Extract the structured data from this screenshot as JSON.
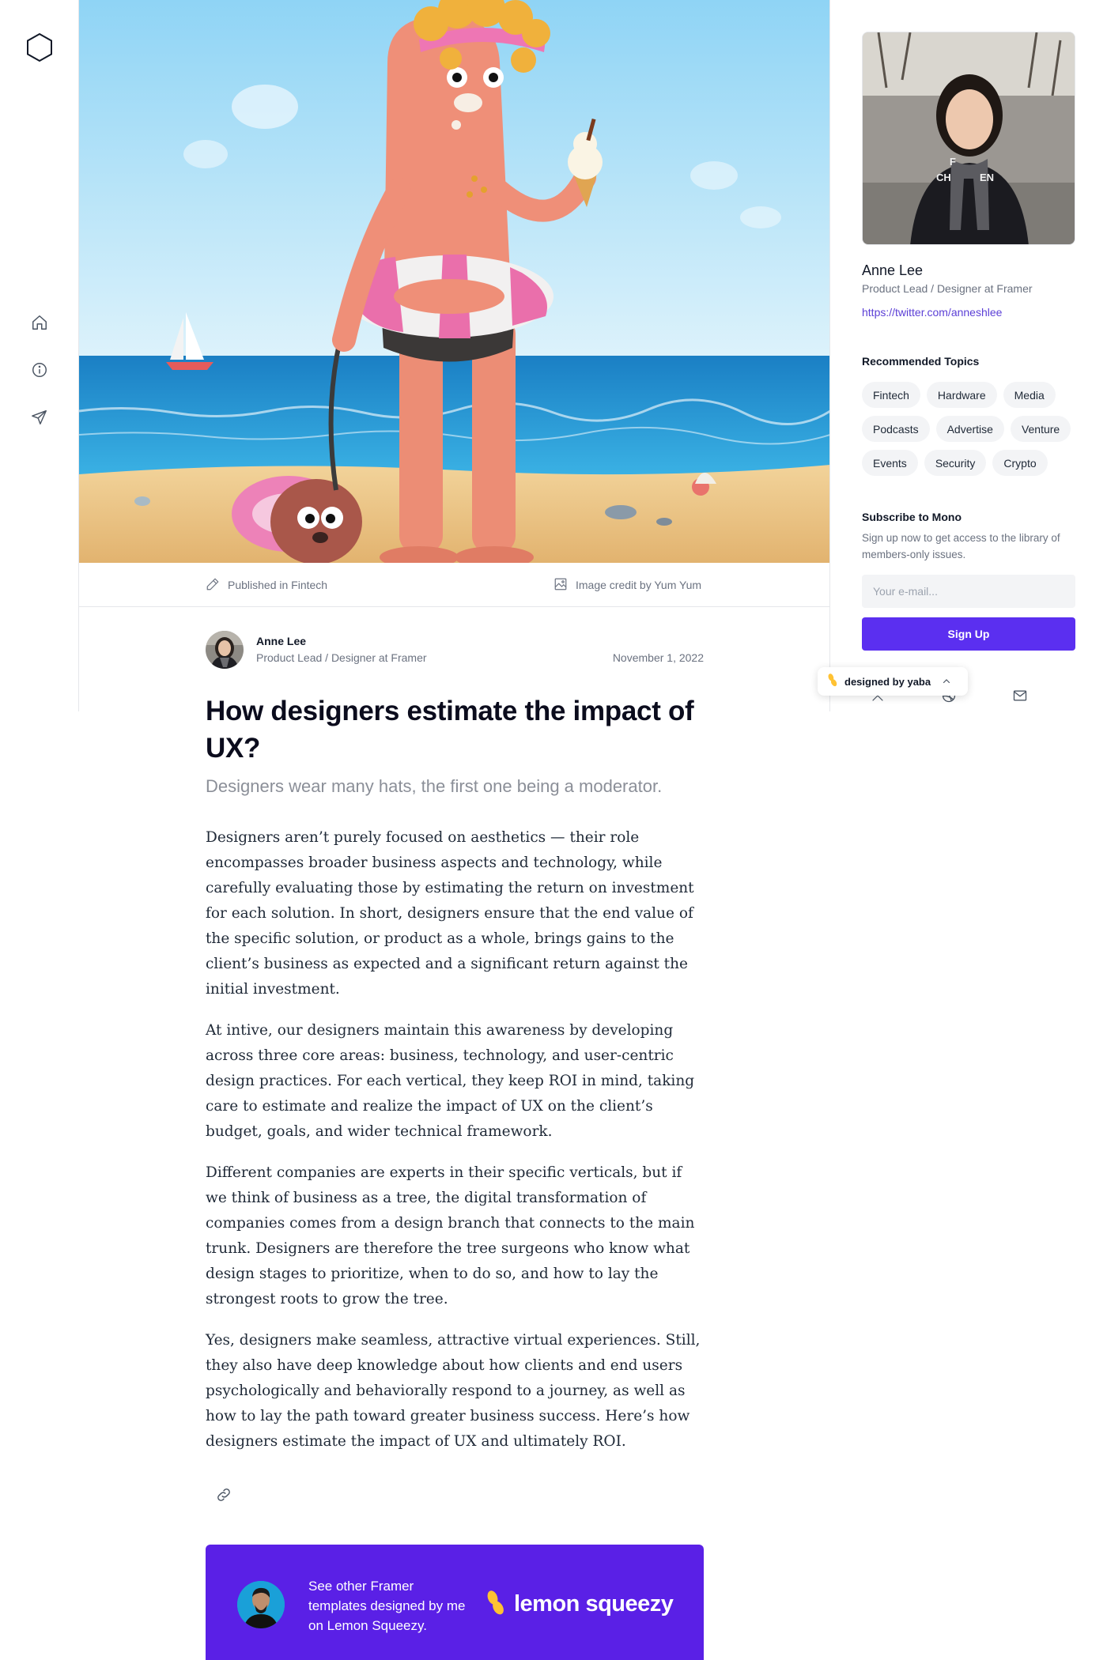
{
  "colors": {
    "accent": "#5b2ff0",
    "promo_background": "#5a20e6",
    "link": "#5b3fd6",
    "brand_yellow": "#ffc233"
  },
  "nav": {
    "logo_icon": "hexagon-icon",
    "items": [
      {
        "icon": "home-icon"
      },
      {
        "icon": "info-icon"
      },
      {
        "icon": "send-icon"
      }
    ]
  },
  "hero": {
    "published_label": "Published in Fintech",
    "image_credit": "Image credit by Yum Yum"
  },
  "article": {
    "author_name": "Anne Lee",
    "author_role": "Product Lead / Designer at Framer",
    "date": "November 1, 2022",
    "title": "How designers estimate the impact of UX?",
    "subtitle": "Designers wear many hats, the first one being a moderator.",
    "paragraphs": [
      "Designers aren’t purely focused on aesthetics — their role encompasses broader business aspects and technology, while carefully evaluating those by estimating the return on investment for each solution. In short, designers ensure that the end value of the specific solution, or product as a whole, brings gains to the client’s business as expected and a significant return against the initial investment.",
      "At intive, our designers maintain this awareness by developing across three core areas: business, technology, and user-centric design practices. For each vertical, they keep ROI in mind, taking care to estimate and realize the impact of UX on the client’s budget, goals, and wider technical framework.",
      "Different companies are experts in their specific verticals, but if we think of business as a tree, the digital transformation of companies comes from a design branch that connects to the main trunk. Designers are therefore the tree surgeons who know what design stages to prioritize, when to do so, and how to lay the strongest roots to grow the tree.",
      "Yes, designers make seamless, attractive virtual experiences. Still, they also have deep knowledge about how clients and end users psychologically and behaviorally respond to a journey, as well as how to lay the path toward greater business success. Here’s how designers estimate the impact of UX and ultimately ROI."
    ]
  },
  "promo": {
    "text": "See other Framer templates designed by me on Lemon Squeezy.",
    "brand": "lemon squeezy"
  },
  "sidebar": {
    "name": "Anne Lee",
    "role": "Product Lead / Designer at Framer",
    "link": "https://twitter.com/anneshlee",
    "topics_heading": "Recommended Topics",
    "topics": [
      "Fintech",
      "Hardware",
      "Media",
      "Podcasts",
      "Advertise",
      "Venture",
      "Events",
      "Security",
      "Crypto"
    ],
    "subscribe_heading": "Subscribe to Mono",
    "subscribe_desc": "Sign up now to get access to the library of members-only issues.",
    "email_placeholder": "Your e-mail...",
    "signup_label": "Sign Up",
    "social_icons": [
      "x-icon",
      "dribbble-icon",
      "mail-icon"
    ]
  },
  "badge": {
    "text": "designed by yaba"
  }
}
